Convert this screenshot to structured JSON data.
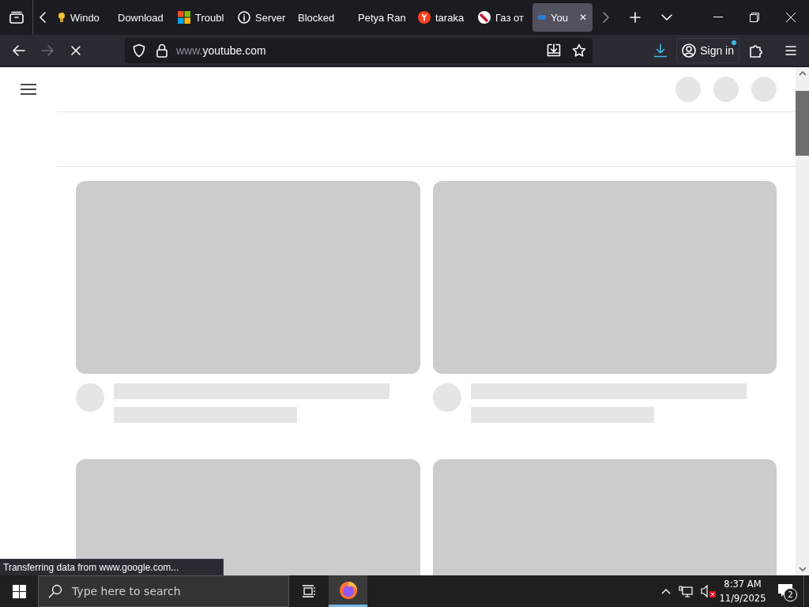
{
  "tabs": [
    {
      "label": "Windo",
      "kind": "bulb",
      "selected": false
    },
    {
      "label": "Download",
      "kind": "plain",
      "selected": false
    },
    {
      "label": "Troubl",
      "kind": "squares",
      "selected": false
    },
    {
      "label": "Server",
      "kind": "info",
      "selected": false
    },
    {
      "label": "Blocked",
      "kind": "plain",
      "selected": false
    },
    {
      "label": "Petya Ran",
      "kind": "plain",
      "selected": false
    },
    {
      "label": "taraka",
      "kind": "letter",
      "selected": false
    },
    {
      "label": "Газ от",
      "kind": "roundlogo",
      "selected": false
    },
    {
      "label": "You",
      "kind": "loading",
      "selected": true
    }
  ],
  "close_tab": "✕",
  "toolbar": {
    "loading": true,
    "url_prefix": "www.",
    "url_host": "youtube.com",
    "download_active": true,
    "sign_in": "Sign in",
    "sign_in_badge": true
  },
  "feed": [
    {
      "kind": "video-placeholder"
    },
    {
      "kind": "video-placeholder"
    },
    {
      "kind": "thumbnail-only"
    },
    {
      "kind": "thumbnail-only"
    }
  ],
  "status_text": "Transferring data from www.google.com...",
  "taskbar": {
    "search_placeholder": "Type here to search",
    "time": "8:37 AM",
    "date": "11/9/2025",
    "notifications": "2",
    "sound_muted": true
  }
}
